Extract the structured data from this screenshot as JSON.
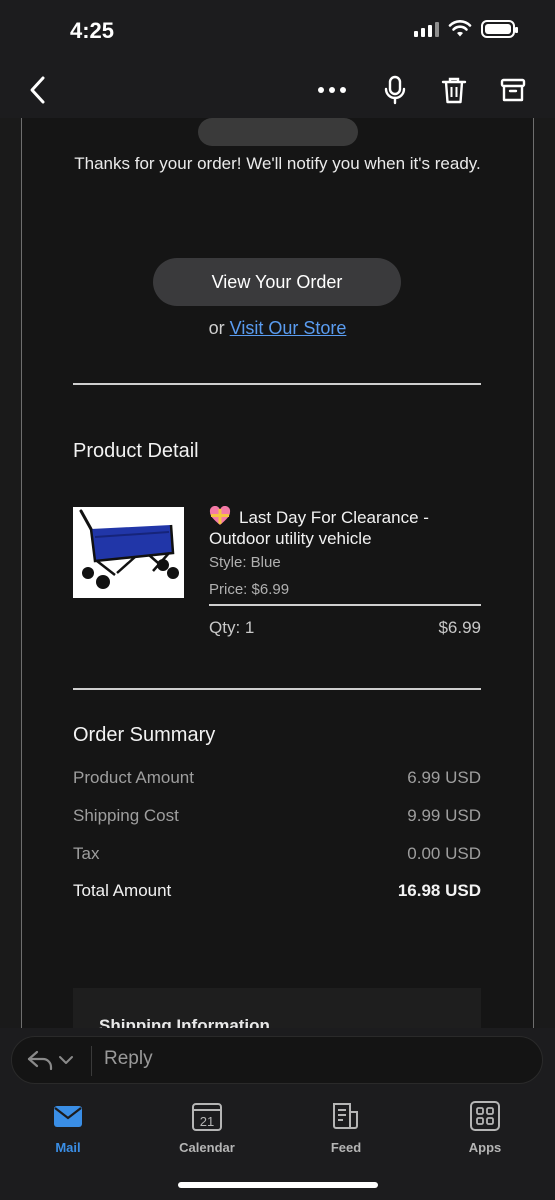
{
  "status_bar": {
    "time": "4:25"
  },
  "nav": {
    "icons": [
      "back-icon",
      "more-icon",
      "microphone-icon",
      "trash-icon",
      "archive-icon"
    ]
  },
  "email": {
    "thanks_text": "Thanks for your order! We'll notify you when it's ready.",
    "view_order_label": "View Your Order",
    "store_prefix": "or",
    "store_link": "Visit Our Store",
    "product_section_title": "Product Detail",
    "product": {
      "name": "Last Day For Clearance - Outdoor utility vehicle",
      "style": "Style: Blue",
      "price": "Price: $6.99",
      "qty": "Qty: 1",
      "line_total": "$6.99"
    },
    "order_summary": {
      "title": "Order Summary",
      "rows": [
        {
          "label": "Product Amount",
          "value": "6.99 USD"
        },
        {
          "label": "Shipping Cost",
          "value": "9.99 USD"
        },
        {
          "label": "Tax",
          "value": "0.00 USD"
        }
      ],
      "total": {
        "label": "Total Amount",
        "value": "16.98 USD"
      }
    },
    "shipping_title": "Shipping Information"
  },
  "reply": {
    "placeholder": "Reply"
  },
  "tabs": [
    {
      "label": "Mail",
      "icon": "mail-icon",
      "active": true
    },
    {
      "label": "Calendar",
      "icon": "calendar-icon",
      "day": "21"
    },
    {
      "label": "Feed",
      "icon": "feed-icon"
    },
    {
      "label": "Apps",
      "icon": "apps-icon"
    }
  ],
  "colors": {
    "accent": "#3a8ee6",
    "link": "#5a9cf0",
    "background": "#151515"
  }
}
